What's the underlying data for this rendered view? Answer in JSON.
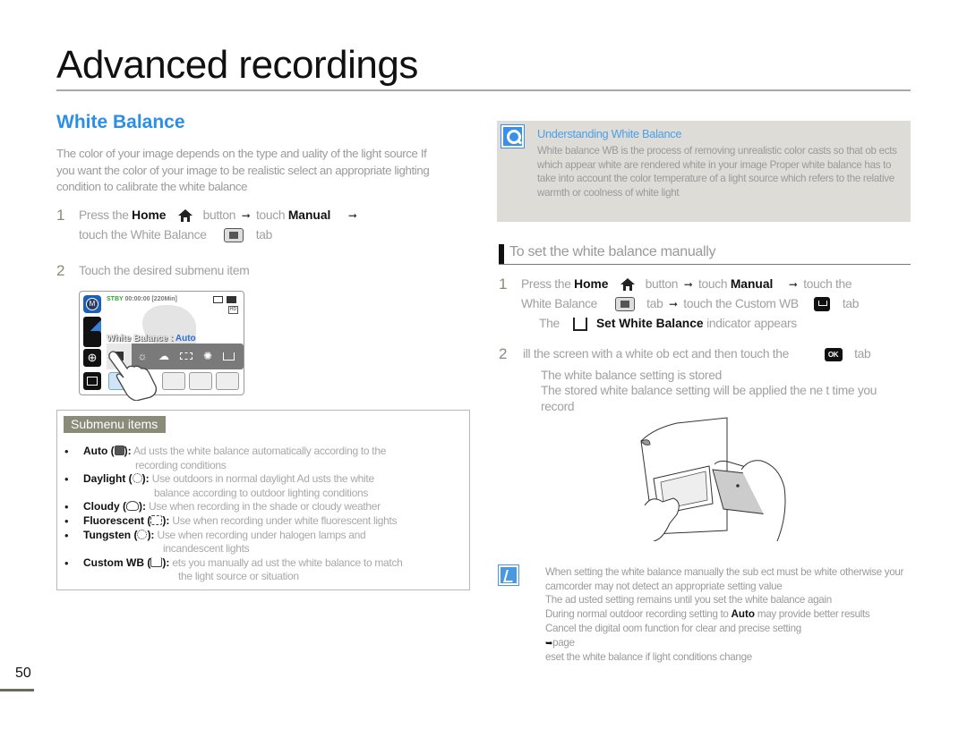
{
  "page": {
    "title": "Advanced recordings",
    "number": "50"
  },
  "left": {
    "section_title": "White Balance",
    "intro": "The color of your image depends on the type and  uality of the light source  If you want the color of your image to be realistic  select an appropriate lighting condition to calibrate the white balance",
    "steps": [
      {
        "num": "1",
        "t1": "Press the",
        "home": "Home",
        "t2": "button",
        "t3": "touch",
        "manual": "Manual",
        "t4": "touch the White Balance",
        "t5": "tab"
      },
      {
        "num": "2",
        "text": "Touch the desired submenu item"
      }
    ],
    "lcd": {
      "mode_icon": "M",
      "status_stby": "STBY",
      "status_time": "00:00:00 [220Min]",
      "wb_label": "White Balance : ",
      "wb_value": "Auto",
      "options": [
        "auto-icon",
        "daylight-icon",
        "cloudy-icon",
        "fluorescent-icon",
        "tungsten-icon",
        "custom-wb-icon"
      ]
    },
    "submenu": {
      "label": "Submenu items",
      "items": [
        {
          "name": "Auto (",
          "icon": "auto-wb-icon",
          "suffix": "):",
          "desc": "Ad usts the white balance automatically according to the",
          "desc2": "recording conditions"
        },
        {
          "name": "Daylight (",
          "icon": "daylight-icon",
          "suffix": "):",
          "desc": "Use outdoors in normal daylight  Ad usts the white",
          "desc2": "balance according to outdoor lighting conditions"
        },
        {
          "name": "Cloudy (",
          "icon": "cloudy-icon",
          "suffix": "):",
          "desc": "Use when recording in the shade or cloudy weather",
          "desc2": ""
        },
        {
          "name": "Fluorescent (",
          "icon": "fluorescent-icon",
          "suffix": "):",
          "desc": "Use when recording under white fluorescent lights",
          "desc2": ""
        },
        {
          "name": "Tungsten (",
          "icon": "tungsten-icon",
          "suffix": "):",
          "desc": "Use when recording under halogen lamps and",
          "desc2": "incandescent lights"
        },
        {
          "name": "Custom WB (",
          "icon": "custom-wb-icon",
          "suffix": "):",
          "desc": " ets you manually ad ust the white balance to match",
          "desc2": "the light source or situation"
        }
      ]
    }
  },
  "right": {
    "info": {
      "title": "Understanding White Balance",
      "text": "White balance  WB  is the process of removing unrealistic color casts so that ob ects which appear white are rendered white in your image  Proper white balance has to take into account the color temperature of a light source  which refers to the relative warmth or coolness of white light"
    },
    "heading": "To set the white balance manually",
    "steps": [
      {
        "num": "1",
        "t1": "Press the",
        "home": "Home",
        "t2": "button",
        "t3": "touch",
        "manual": "Manual",
        "t4": "touch the",
        "t5": "White Balance",
        "t6": "tab",
        "t7": "touch the Custom WB",
        "t8": "tab",
        "sub_t1": "The",
        "sub_bold": "Set White Balance",
        "sub_t2": "indicator appears"
      },
      {
        "num": "2",
        "t1": "ill the screen with a white ob ect  and then touch the",
        "ok": "OK",
        "t2": "tab",
        "sub1": "The white balance setting is stored",
        "sub2": "The stored white balance setting will be applied the ne t time you record"
      }
    ],
    "notes": {
      "n1": "When setting the white balance manually  the sub ect must be white otherwise  your camcorder may not detect an appropriate setting value",
      "n2": "The ad usted setting remains until you set the white balance again",
      "n3a": "During normal outdoor recording  setting to",
      "n3bold": "Auto",
      "n3b": "may provide better results",
      "n4": "Cancel the digital  oom function for clear and precise setting",
      "n4ref": "page",
      "n5": " eset the white balance if light conditions change"
    }
  },
  "colors": {
    "accent_blue": "#2a8fe6",
    "info_bg": "#dedcd6",
    "submenu_label_bg": "#8b8b7a"
  }
}
